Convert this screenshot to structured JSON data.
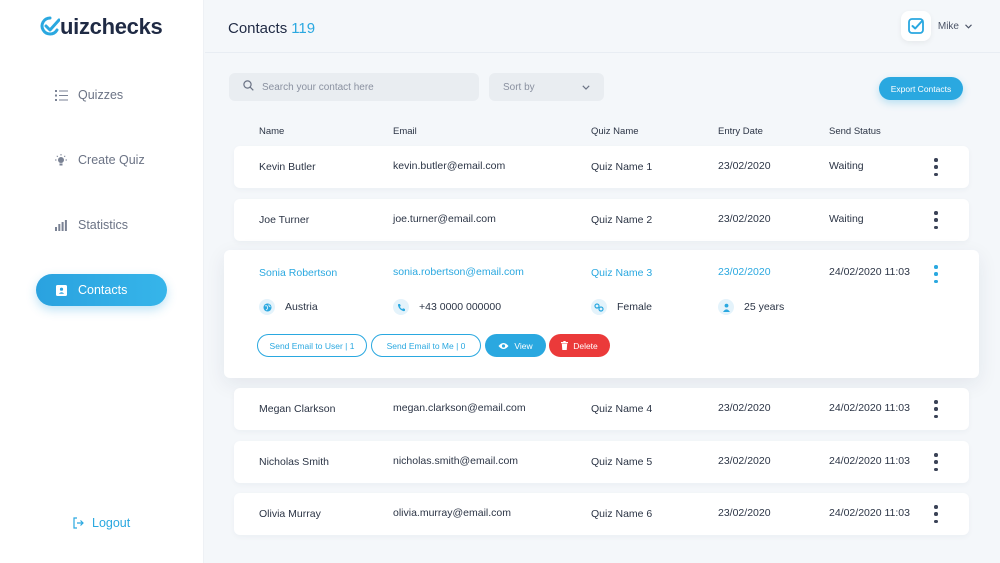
{
  "brand": {
    "logo_q": "Q",
    "logo_rest": "uizchecks"
  },
  "sidebar": {
    "items": [
      {
        "label": "Quizzes",
        "icon": "list-icon"
      },
      {
        "label": "Create Quiz",
        "icon": "lightbulb-icon"
      },
      {
        "label": "Statistics",
        "icon": "bar-chart-icon"
      },
      {
        "label": "Contacts",
        "icon": "contact-card-icon",
        "active": true
      }
    ],
    "logout_label": "Logout"
  },
  "header": {
    "title": "Contacts",
    "count": "119",
    "user_name": "Mike"
  },
  "toolbar": {
    "search_placeholder": "Search your contact here",
    "sort_label": "Sort by",
    "export_label": "Export Contacts"
  },
  "table": {
    "columns": [
      "Name",
      "Email",
      "Quiz Name",
      "Entry Date",
      "Send Status"
    ],
    "rows": [
      {
        "name": "Kevin Butler",
        "email": "kevin.butler@email.com",
        "quiz": "Quiz Name 1",
        "date": "23/02/2020",
        "status": "Waiting"
      },
      {
        "name": "Joe Turner",
        "email": "joe.turner@email.com",
        "quiz": "Quiz Name 2",
        "date": "23/02/2020",
        "status": "Waiting"
      },
      {
        "name": "Sonia Robertson",
        "email": "sonia.robertson@email.com",
        "quiz": "Quiz Name 3",
        "date": "23/02/2020",
        "status": "24/02/2020  11:03"
      },
      {
        "name": "Megan Clarkson",
        "email": "megan.clarkson@email.com",
        "quiz": "Quiz Name 4",
        "date": "23/02/2020",
        "status": "24/02/2020  11:03"
      },
      {
        "name": "Nicholas Smith",
        "email": "nicholas.smith@email.com",
        "quiz": "Quiz Name 5",
        "date": "23/02/2020",
        "status": "24/02/2020  11:03"
      },
      {
        "name": "Olivia Murray",
        "email": "olivia.murray@email.com",
        "quiz": "Quiz Name 6",
        "date": "23/02/2020",
        "status": "24/02/2020  11:03"
      }
    ]
  },
  "expanded": {
    "country": "Austria",
    "phone": "+43 0000 000000",
    "gender": "Female",
    "age": "25 years",
    "send_user_label": "Send Email to User | 1",
    "send_me_label": "Send Email to Me | 0",
    "view_label": "View",
    "delete_label": "Delete"
  },
  "colors": {
    "accent": "#2aa8e0",
    "danger": "#eb3a3a",
    "text": "#2b3445"
  }
}
